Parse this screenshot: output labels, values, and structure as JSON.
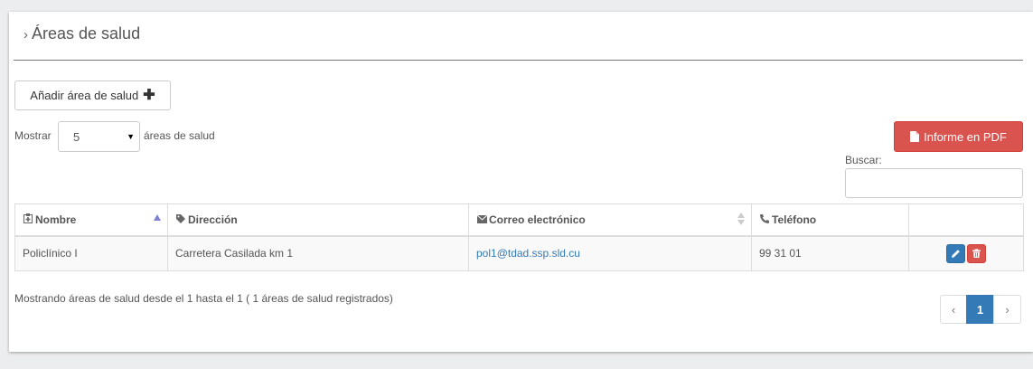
{
  "panel": {
    "title": "Áreas de salud"
  },
  "toolbar": {
    "add_label": "Añadir área de salud",
    "pdf_label": "Informe en PDF"
  },
  "length_menu": {
    "prefix": "Mostrar",
    "selected": "5",
    "suffix": "áreas de salud"
  },
  "search": {
    "label": "Buscar:",
    "value": ""
  },
  "table": {
    "headers": {
      "nombre": "Nombre",
      "direccion": "Dirección",
      "correo": "Correo electrónico",
      "telefono": "Teléfono"
    },
    "rows": [
      {
        "nombre": "Policlínico I",
        "direccion": "Carretera Casilada km 1",
        "correo": "pol1@tdad.ssp.sld.cu",
        "telefono": "99 31 01"
      }
    ]
  },
  "info": "Mostrando áreas de salud desde el 1 hasta el 1 ( 1 áreas de salud registrados)",
  "pagination": {
    "prev": "‹",
    "current": "1",
    "next": "›"
  },
  "colors": {
    "primary": "#337ab7",
    "danger": "#d9534f",
    "sort_active": "#7f7fd1"
  }
}
